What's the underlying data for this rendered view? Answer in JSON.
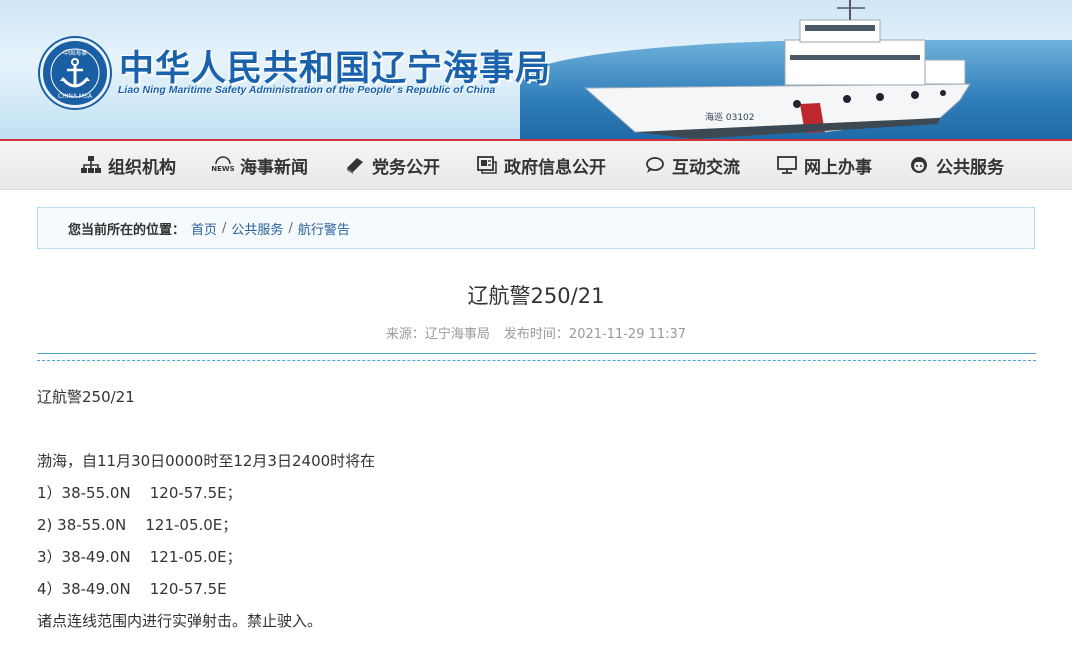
{
  "header": {
    "title": "中华人民共和国辽宁海事局",
    "subtitle": "Liao Ning Maritime Safety Administration of the People' s Republic of China",
    "seal_text_top": "中国海事",
    "seal_text_bottom": "CHINA MSA",
    "ship_hull_text": "海巡 03102"
  },
  "nav": {
    "items": [
      {
        "label": "组织机构",
        "icon": "org-chart-icon"
      },
      {
        "label": "海事新闻",
        "icon": "news-icon"
      },
      {
        "label": "党务公开",
        "icon": "book-icon"
      },
      {
        "label": "政府信息公开",
        "icon": "document-icon"
      },
      {
        "label": "互动交流",
        "icon": "chat-icon"
      },
      {
        "label": "网上办事",
        "icon": "monitor-icon"
      },
      {
        "label": "公共服务",
        "icon": "person-icon"
      }
    ]
  },
  "breadcrumb": {
    "label": "您当前所在的位置：",
    "items": [
      "首页",
      "公共服务",
      "航行警告"
    ],
    "separator": "/"
  },
  "article": {
    "title": "辽航警250/21",
    "source": "来源：辽宁海事局",
    "published": "发布时间：2021-11-29 11:37",
    "lines": [
      "辽航警250/21",
      "",
      "渤海，自11月30日0000时至12月3日2400时将在",
      "1）38-55.0N    120-57.5E；",
      "2) 38-55.0N    121-05.0E；",
      "3）38-49.0N    121-05.0E；",
      "4）38-49.0N    120-57.5E",
      "诸点连线范围内进行实弹射击。禁止驶入。"
    ]
  },
  "colors": {
    "brand_blue": "#1a62ac",
    "nav_accent_red": "#d0323a",
    "divider_blue": "#4ba3d6",
    "link_blue": "#2a5f9a"
  }
}
